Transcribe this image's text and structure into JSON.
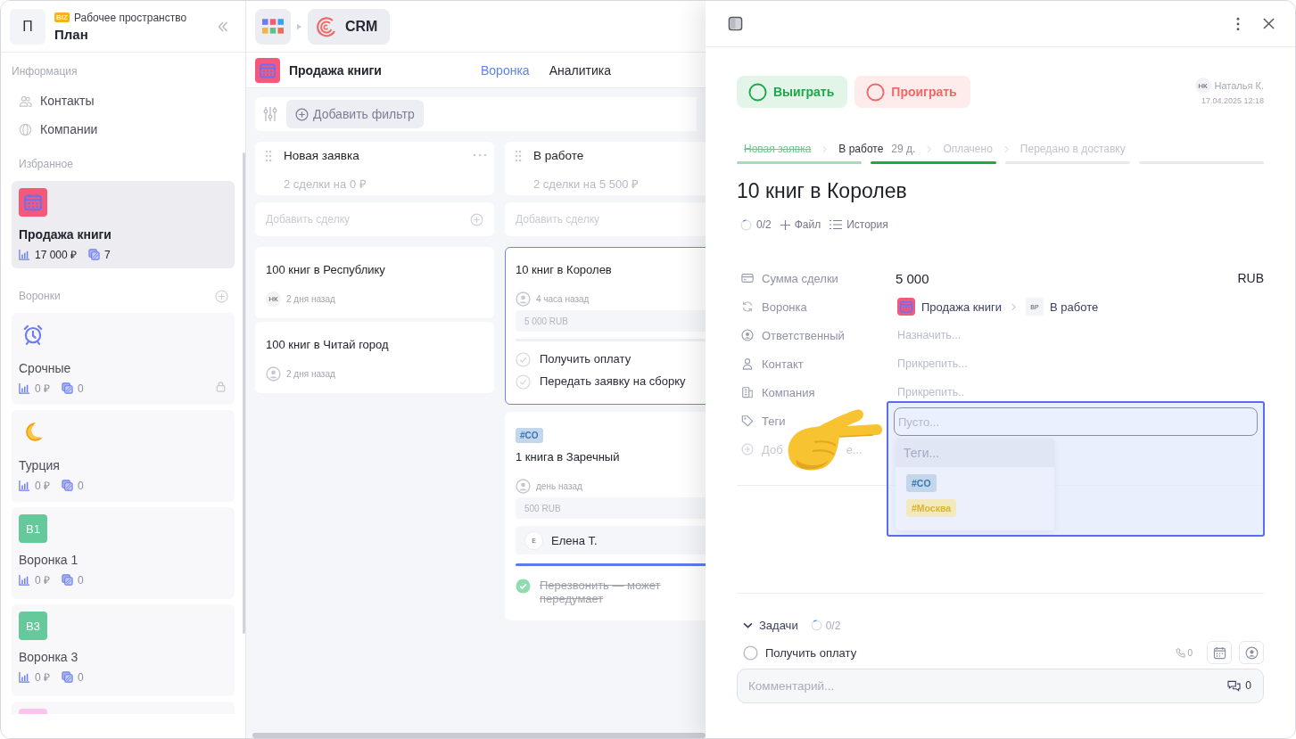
{
  "sidebar": {
    "workspace": {
      "avatar": "П",
      "badge": "BIZ",
      "caption": "Рабочее пространство",
      "name": "План"
    },
    "info_title": "Информация",
    "info_items": [
      {
        "label": "Контакты"
      },
      {
        "label": "Компании"
      }
    ],
    "favorites_title": "Избранное",
    "favorites": [
      {
        "name": "Продажа книги",
        "icon": {
          "kind": "calendar",
          "color": "#f5587a"
        },
        "amount": "17 000 ₽",
        "count": "7",
        "selected": true,
        "locked": false
      }
    ],
    "funnels_title": "Воронки",
    "funnels": [
      {
        "name": "Срочные",
        "icon": {
          "kind": "alarm"
        },
        "amount": "0 ₽",
        "count": "0",
        "selected": false,
        "locked": true
      },
      {
        "name": "Турция",
        "icon": {
          "kind": "moon"
        },
        "amount": "0 ₽",
        "count": "0",
        "selected": false,
        "locked": false
      },
      {
        "name": "Воронка 1",
        "icon": {
          "kind": "text",
          "text": "В1",
          "color": "#66c99b"
        },
        "amount": "0 ₽",
        "count": "0",
        "selected": false,
        "locked": false
      },
      {
        "name": "Воронка 3",
        "icon": {
          "kind": "text",
          "text": "В3",
          "color": "#66c99b"
        },
        "amount": "0 ₽",
        "count": "0",
        "selected": false,
        "locked": false
      },
      {
        "icon": {
          "kind": "text",
          "color": "#fbc4ee"
        },
        "selected": false
      }
    ]
  },
  "main": {
    "app": {
      "name": "CRM"
    },
    "board": {
      "name": "Продажа книги"
    },
    "tabs": [
      {
        "label": "Воронка",
        "selected": true
      },
      {
        "label": "Аналитика",
        "selected": false
      }
    ],
    "filter_button": "Добавить фильтр",
    "columns": [
      {
        "title": "Новая заявка",
        "summary": "2 сделки на 0 ₽",
        "has_menu": true,
        "add_deal": "Добавить сделку",
        "has_add_icon": true,
        "deals": [
          {
            "title": "100 книг в Республику",
            "owner": {
              "kind": "initials",
              "text": "НК"
            },
            "time": "2 дня назад",
            "selected": false
          },
          {
            "title": "100 книг в Читай город",
            "owner": {
              "kind": "user"
            },
            "time": "2 дня назад",
            "selected": false
          }
        ]
      },
      {
        "title": "В работе",
        "summary": "2 сделки на 5 500 ₽",
        "has_menu": false,
        "add_deal": "Добавить сделку",
        "has_add_icon": false,
        "deals": [
          {
            "title": "10 книг в Королев",
            "owner": {
              "kind": "user"
            },
            "time": "4 часа назад",
            "amount": "5 000 RUB",
            "tasks": [
              {
                "label": "Получить оплату",
                "done": false
              },
              {
                "label": "Передать заявку на сборку",
                "done": false
              }
            ],
            "selected": true
          },
          {
            "tag": {
              "text": "#CO",
              "color": "#3a78b8"
            },
            "title": "1 книга в Заречный",
            "owner": {
              "kind": "user"
            },
            "time": "день назад",
            "amount": "500 RUB",
            "contact": {
              "initial": "Е",
              "name": "Елена Т."
            },
            "tasks": [
              {
                "label": "Перезвонить — может передумает",
                "done": true
              }
            ],
            "selected": false
          }
        ]
      }
    ]
  },
  "panel": {
    "outcomes": [
      {
        "kind": "win",
        "label": "Выиграть"
      },
      {
        "kind": "lose",
        "label": "Проиграть"
      }
    ],
    "author": {
      "initials": "НК",
      "name": "Наталья К.",
      "date": "17.04.2025 12:18"
    },
    "stages": [
      {
        "label": "Новая заявка",
        "completed": true,
        "selected": false
      },
      {
        "label": "В работе",
        "duration": "29 д.",
        "completed": false,
        "selected": true
      },
      {
        "label": "Оплачено",
        "completed": false,
        "selected": false
      },
      {
        "label": "Передано в доставку",
        "completed": false,
        "selected": false
      }
    ],
    "title": "10 книг в Королев",
    "actions": [
      {
        "kind": "progress",
        "label": "0/2"
      },
      {
        "kind": "add",
        "label": "Файл"
      },
      {
        "kind": "list",
        "label": "История"
      }
    ],
    "fields": [
      {
        "kind": "amount",
        "label": "Сумма сделки",
        "value": "5 000",
        "currency": "RUB"
      },
      {
        "kind": "pipeline",
        "label": "Воронка",
        "board": "Продажа книги",
        "stage_badge": "ВР",
        "stage": "В работе"
      },
      {
        "kind": "placeholder",
        "label": "Ответственный",
        "placeholder": "Назначить..."
      },
      {
        "kind": "placeholder",
        "label": "Контакт",
        "placeholder": "Прикрепить..."
      },
      {
        "kind": "placeholder",
        "label": "Компания",
        "placeholder": "Прикрепить.."
      },
      {
        "kind": "tags",
        "label": "Теги"
      },
      {
        "kind": "add",
        "label_start": "Доб",
        "label_end": "е..."
      }
    ],
    "tags_popup": {
      "placeholder": "Пусто...",
      "header": "Теги...",
      "options": [
        {
          "text": "#CO",
          "color": "#3a78b8"
        },
        {
          "text": "#Москва",
          "color": "#d8b62a"
        }
      ]
    },
    "tasks": {
      "title": "Задачи",
      "progress": "0/2",
      "expanded": true,
      "items": [
        {
          "label": "Получить оплату",
          "done": false,
          "calls": "0"
        }
      ]
    },
    "comment": {
      "placeholder": "Комментарий...",
      "count": "0"
    }
  }
}
